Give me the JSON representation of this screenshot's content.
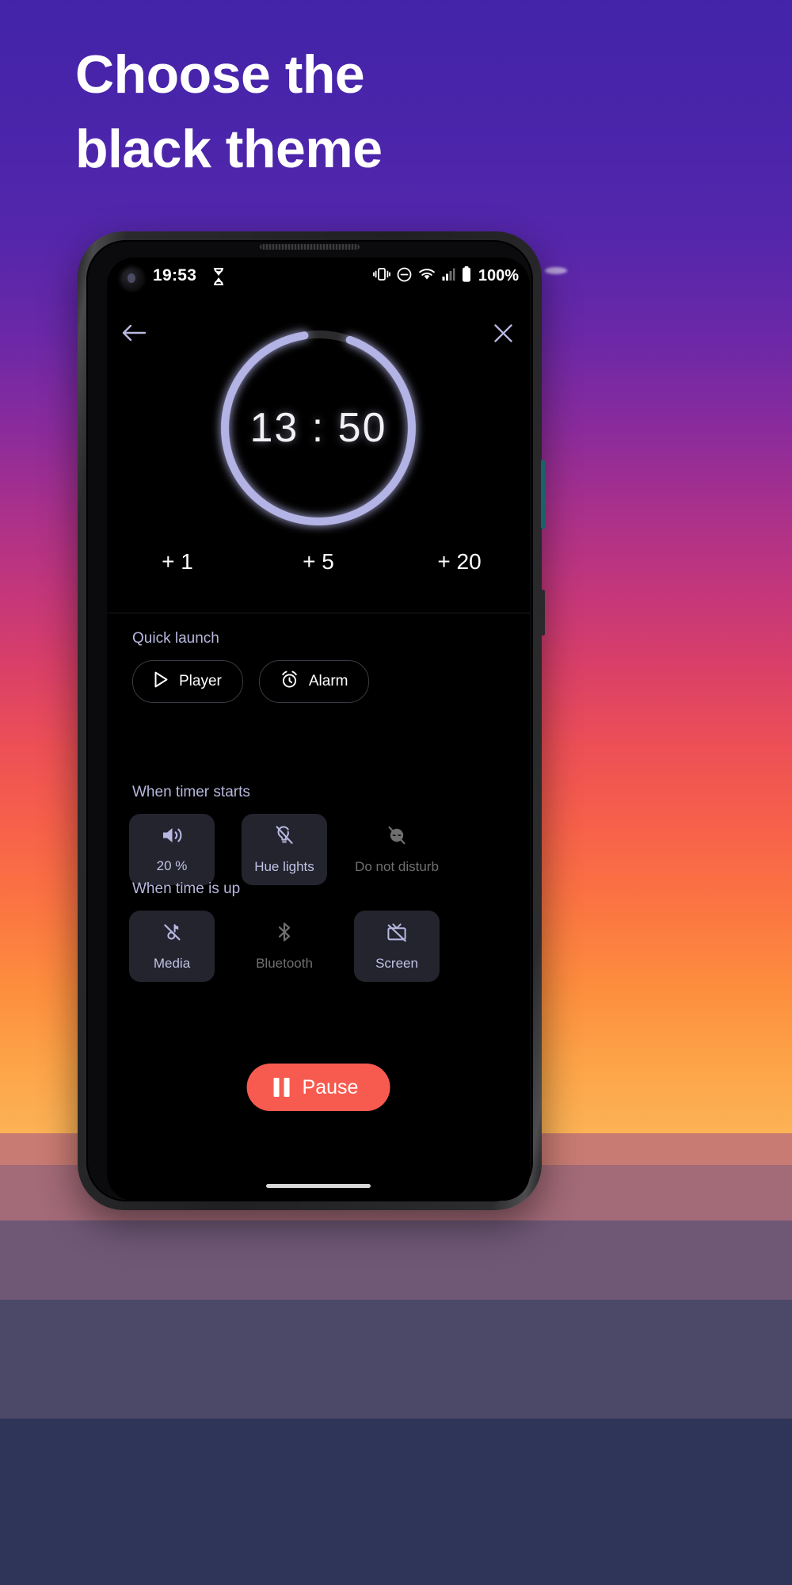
{
  "promo": {
    "headline_line1": "Choose the",
    "headline_line2": "black theme",
    "headline_color": "#ffffff"
  },
  "theme": {
    "accent_lavender": "#b7b7dd",
    "ring_color": "#b3b3e6",
    "pause_red": "#f75b50",
    "tile_bg": "#23242e",
    "disabled_gray": "#6f6f6f",
    "screen_bg": "#000000"
  },
  "statusbar": {
    "time": "19:53",
    "battery": "100%",
    "icons": [
      "hourglass-icon",
      "vibrate-icon",
      "do-not-disturb-icon",
      "wifi-icon",
      "signal-icon",
      "battery-icon"
    ]
  },
  "nav": {
    "back_icon": "arrow-left-icon",
    "close_icon": "close-icon"
  },
  "timer": {
    "display": "13 : 50",
    "progress_percent": 92,
    "gap_label": "ring-gap-top"
  },
  "add_buttons": [
    {
      "label": "+ 1",
      "name": "add-1-minute-button"
    },
    {
      "label": "+ 5",
      "name": "add-5-minutes-button"
    },
    {
      "label": "+ 20",
      "name": "add-20-minutes-button"
    }
  ],
  "quick_launch": {
    "title": "Quick launch",
    "items": [
      {
        "label": "Player",
        "icon": "play-icon"
      },
      {
        "label": "Alarm",
        "icon": "alarm-clock-icon"
      }
    ]
  },
  "when_timer_starts": {
    "title": "When timer starts",
    "items": [
      {
        "label": "20 %",
        "icon": "volume-up-icon",
        "enabled": true
      },
      {
        "label": "Hue lights",
        "icon": "lightbulb-off-icon",
        "enabled": true
      },
      {
        "label": "Do not disturb",
        "icon": "do-not-disturb-off-icon",
        "enabled": false
      }
    ]
  },
  "when_time_is_up": {
    "title": "When time is up",
    "items": [
      {
        "label": "Media",
        "icon": "music-note-off-icon",
        "enabled": true
      },
      {
        "label": "Bluetooth",
        "icon": "bluetooth-icon",
        "enabled": false
      },
      {
        "label": "Screen",
        "icon": "tv-off-icon",
        "enabled": true
      }
    ]
  },
  "primary_action": {
    "label": "Pause",
    "icon": "pause-icon"
  }
}
